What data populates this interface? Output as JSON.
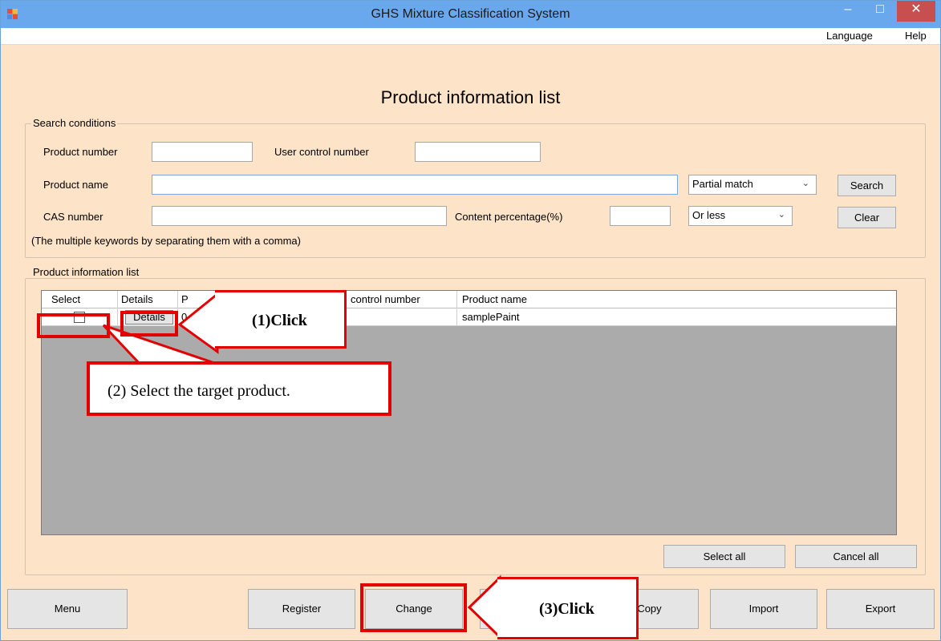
{
  "window": {
    "title": "GHS Mixture Classification System",
    "minimize": "–",
    "maximize": "□",
    "close": "✕"
  },
  "menu": [
    "Language",
    "Help"
  ],
  "page_title": "Product information list",
  "search": {
    "group_label": "Search conditions",
    "product_number_label": "Product number",
    "product_number_value": "",
    "user_control_label": "User control number",
    "user_control_value": "",
    "product_name_label": "Product name",
    "product_name_value": "",
    "name_match_mode": "Partial match",
    "search_button": "Search",
    "cas_label": "CAS number",
    "cas_value": "",
    "content_label": "Content percentage(%)",
    "content_value": "",
    "content_mode": "Or less",
    "clear_button": "Clear",
    "hint": "(The multiple keywords by separating them with a comma)"
  },
  "list": {
    "group_label": "Product information list",
    "columns": [
      "Select",
      "Details",
      "P",
      "control number",
      "Product name"
    ],
    "rows": [
      {
        "selected": false,
        "details_button": "Details",
        "product_number": "0",
        "user_control_number": "",
        "product_name": "samplePaint"
      }
    ],
    "select_all": "Select all",
    "cancel_all": "Cancel all"
  },
  "footer_buttons": {
    "menu": "Menu",
    "register": "Register",
    "change": "Change",
    "copy": "Copy",
    "import": "Import",
    "export": "Export"
  },
  "annotations": {
    "click_details": "(1)Click",
    "select_target": "(2) Select the target product.",
    "click_change": "(3)Click"
  },
  "colors": {
    "background": "#fde3c8",
    "titlebar": "#6aa8ee",
    "close_button": "#c74f4f",
    "annotation_red": "#e30000",
    "grid_empty": "#ababab"
  },
  "icons": [
    "app-icon",
    "minimize-icon",
    "maximize-icon",
    "close-icon",
    "chevron-down-icon",
    "checkbox-icon"
  ]
}
